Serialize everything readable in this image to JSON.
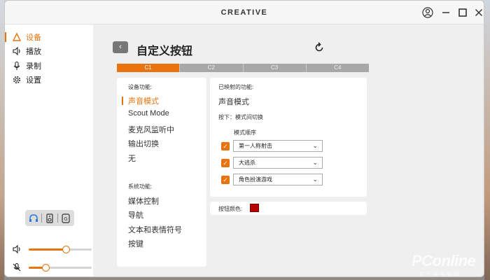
{
  "titlebar": {
    "brand": "CREATIVE"
  },
  "sidebar": {
    "items": [
      {
        "label": "设备",
        "icon": "device-icon",
        "active": true
      },
      {
        "label": "播放",
        "icon": "speaker-icon",
        "active": false
      },
      {
        "label": "录制",
        "icon": "microphone-icon",
        "active": false
      },
      {
        "label": "设置",
        "icon": "gear-icon",
        "active": false
      }
    ],
    "devices": [
      "headphone-icon",
      "speaker-device-icon",
      "gaming-device-icon"
    ],
    "output_volume": 0.59,
    "mic_volume": 0.27
  },
  "main": {
    "title": "自定义按钮",
    "tabs": [
      {
        "label": "C1",
        "active": true
      },
      {
        "label": "C2",
        "active": false
      },
      {
        "label": "C3",
        "active": false
      },
      {
        "label": "C4",
        "active": false
      }
    ],
    "device_functions_label": "设备功能:",
    "device_functions": [
      "声音模式",
      "Scout Mode",
      "麦克风监听中",
      "输出切换",
      "无"
    ],
    "system_functions_label": "系统功能:",
    "system_functions": [
      "媒体控制",
      "导航",
      "文本和表情符号",
      "按键"
    ],
    "mapped_label": "已映射的功能:",
    "mapped_value": "声音模式",
    "press_label": "按下：模式间切换",
    "mode_order_label": "模式顺序",
    "modes": [
      {
        "checked": true,
        "value": "第一人称射击"
      },
      {
        "checked": true,
        "value": "大逃杀"
      },
      {
        "checked": true,
        "value": "角色扮演游戏"
      }
    ],
    "button_color_label": "按钮颜色:",
    "button_color": "#b80000"
  },
  "colors": {
    "accent": "#e8730f"
  },
  "watermark": {
    "main": "PConline",
    "sub": "太平洋电脑网"
  }
}
